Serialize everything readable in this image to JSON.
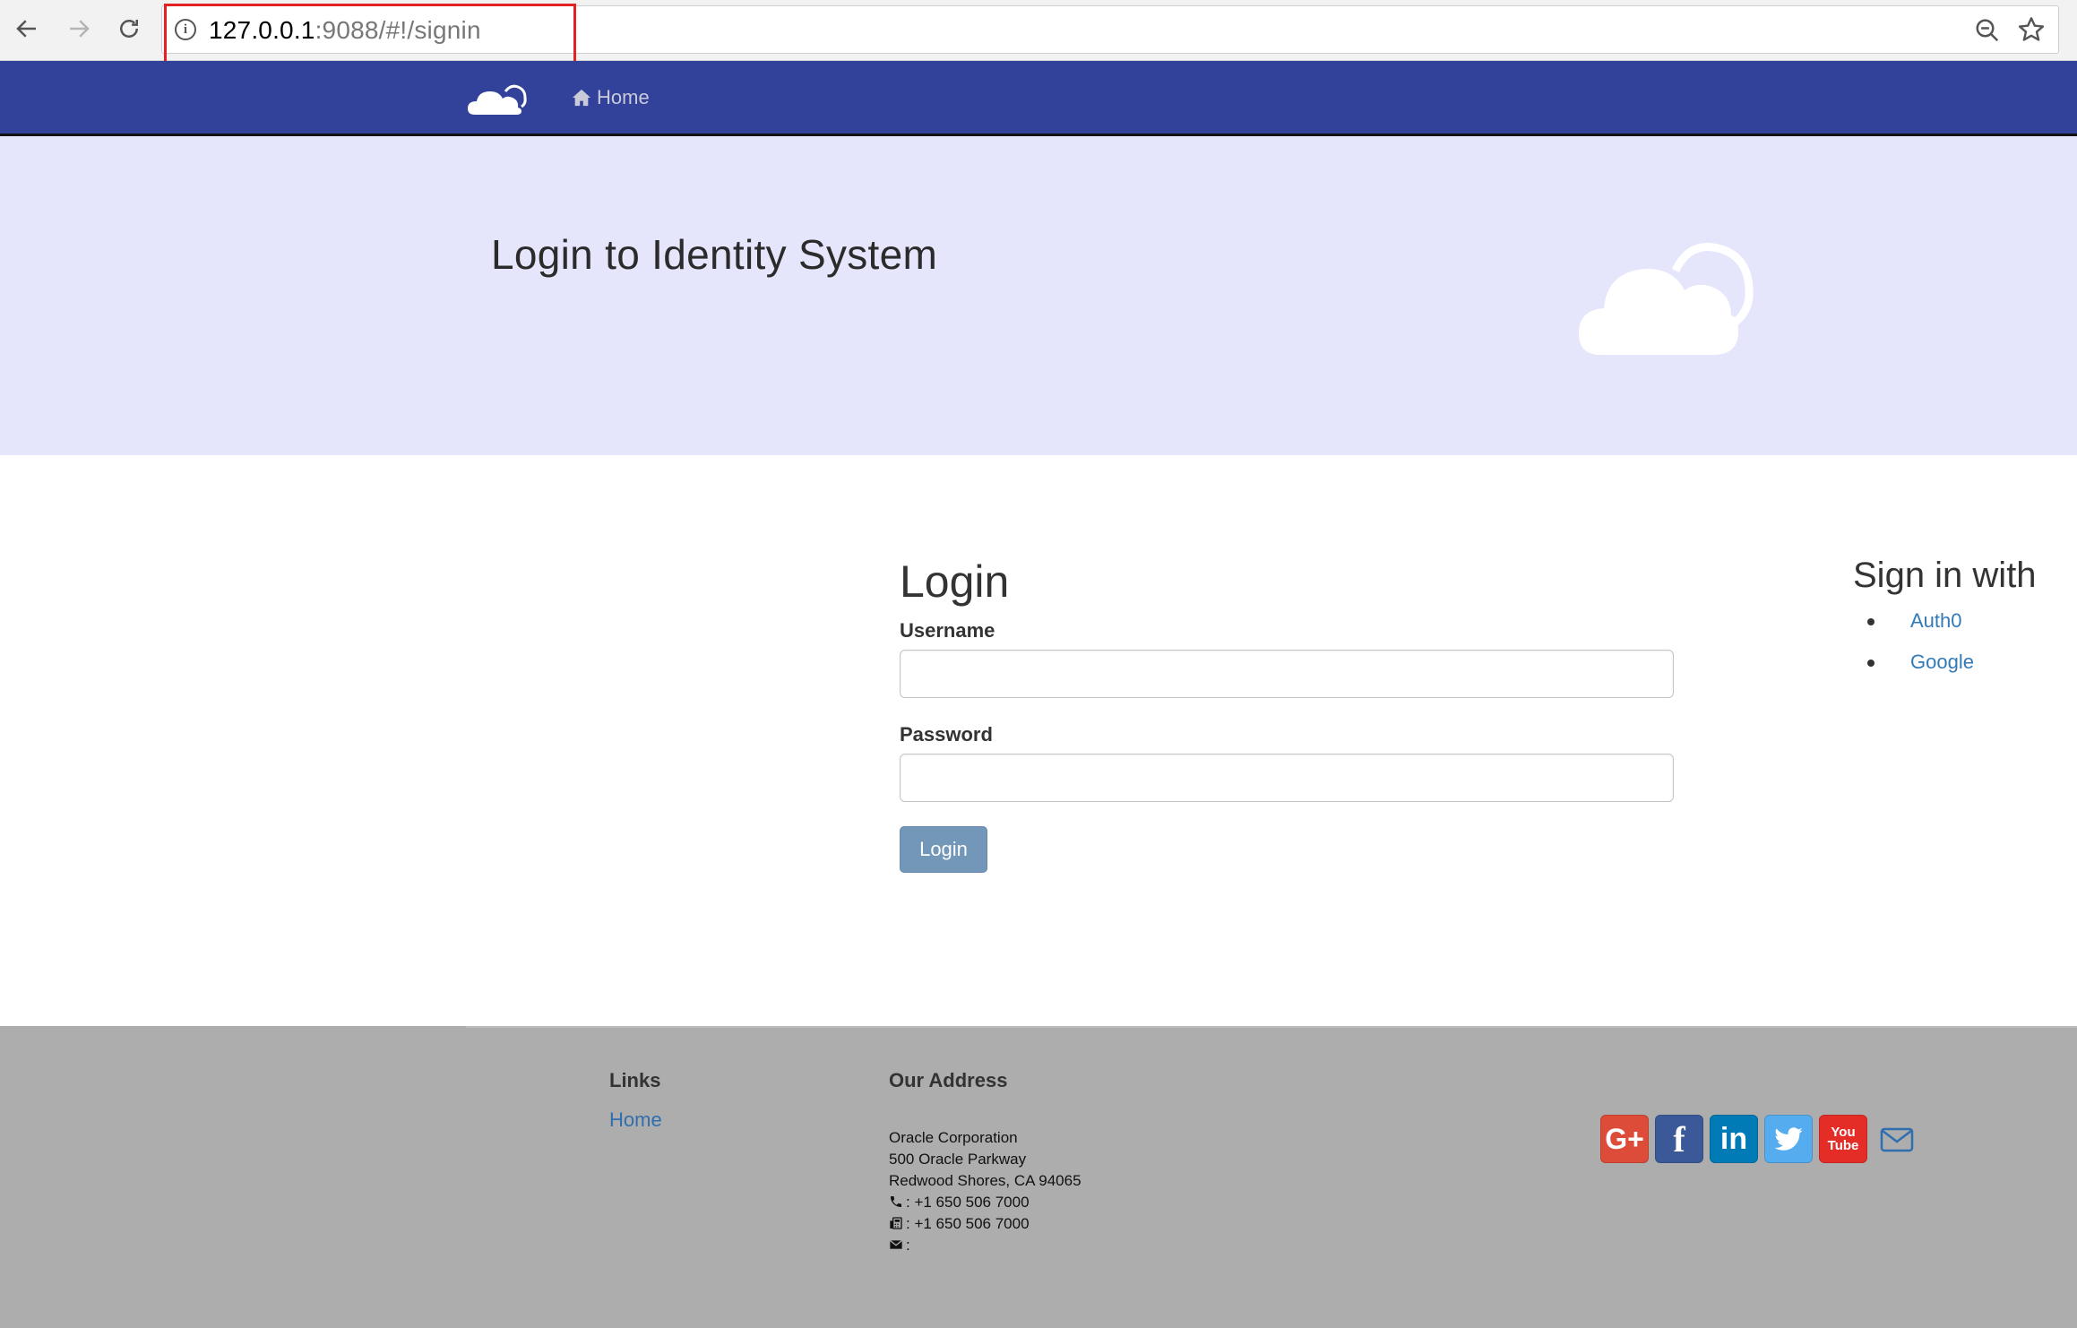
{
  "browser": {
    "url_host": "127.0.0.1",
    "url_rest": ":9088/#!/signin"
  },
  "navbar": {
    "home_label": "Home"
  },
  "jumbotron": {
    "title": "Login to Identity System"
  },
  "login_form": {
    "heading": "Login",
    "username_label": "Username",
    "username_value": "",
    "password_label": "Password",
    "password_value": "",
    "submit_label": "Login"
  },
  "social_signin": {
    "heading": "Sign in with",
    "providers": [
      "Auth0",
      "Google"
    ]
  },
  "footer": {
    "links_heading": "Links",
    "links": [
      "Home"
    ],
    "address_heading": "Our Address",
    "address_lines": [
      "Oracle Corporation",
      "500 Oracle Parkway",
      "Redwood Shores, CA 94065"
    ],
    "phone": ": +1 650 506 7000",
    "fax": ": +1 650 506 7000",
    "email": ":",
    "social_icons": [
      "google-plus-icon",
      "facebook-icon",
      "linkedin-icon",
      "twitter-icon",
      "youtube-icon",
      "envelope-icon"
    ]
  },
  "colors": {
    "navbar": "#32429b",
    "jumbotron": "#e5e6fc",
    "footer": "#adadad",
    "link": "#337ab7",
    "button": "#7397b8",
    "highlight": "#e32323"
  }
}
